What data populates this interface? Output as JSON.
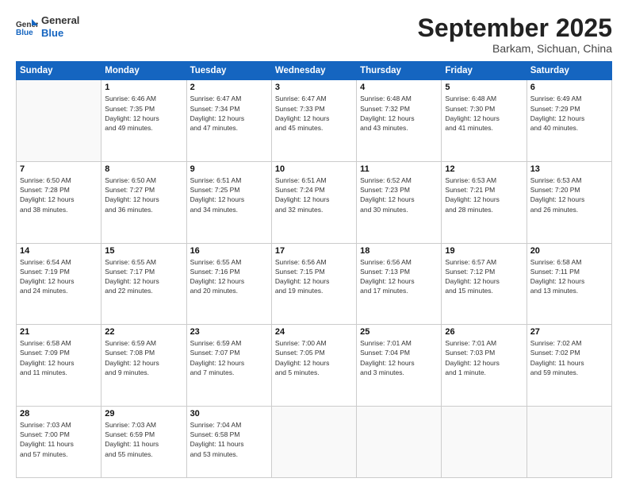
{
  "header": {
    "logo_line1": "General",
    "logo_line2": "Blue",
    "month_title": "September 2025",
    "subtitle": "Barkam, Sichuan, China"
  },
  "weekdays": [
    "Sunday",
    "Monday",
    "Tuesday",
    "Wednesday",
    "Thursday",
    "Friday",
    "Saturday"
  ],
  "weeks": [
    [
      {
        "day": "",
        "info": ""
      },
      {
        "day": "1",
        "info": "Sunrise: 6:46 AM\nSunset: 7:35 PM\nDaylight: 12 hours\nand 49 minutes."
      },
      {
        "day": "2",
        "info": "Sunrise: 6:47 AM\nSunset: 7:34 PM\nDaylight: 12 hours\nand 47 minutes."
      },
      {
        "day": "3",
        "info": "Sunrise: 6:47 AM\nSunset: 7:33 PM\nDaylight: 12 hours\nand 45 minutes."
      },
      {
        "day": "4",
        "info": "Sunrise: 6:48 AM\nSunset: 7:32 PM\nDaylight: 12 hours\nand 43 minutes."
      },
      {
        "day": "5",
        "info": "Sunrise: 6:48 AM\nSunset: 7:30 PM\nDaylight: 12 hours\nand 41 minutes."
      },
      {
        "day": "6",
        "info": "Sunrise: 6:49 AM\nSunset: 7:29 PM\nDaylight: 12 hours\nand 40 minutes."
      }
    ],
    [
      {
        "day": "7",
        "info": "Sunrise: 6:50 AM\nSunset: 7:28 PM\nDaylight: 12 hours\nand 38 minutes."
      },
      {
        "day": "8",
        "info": "Sunrise: 6:50 AM\nSunset: 7:27 PM\nDaylight: 12 hours\nand 36 minutes."
      },
      {
        "day": "9",
        "info": "Sunrise: 6:51 AM\nSunset: 7:25 PM\nDaylight: 12 hours\nand 34 minutes."
      },
      {
        "day": "10",
        "info": "Sunrise: 6:51 AM\nSunset: 7:24 PM\nDaylight: 12 hours\nand 32 minutes."
      },
      {
        "day": "11",
        "info": "Sunrise: 6:52 AM\nSunset: 7:23 PM\nDaylight: 12 hours\nand 30 minutes."
      },
      {
        "day": "12",
        "info": "Sunrise: 6:53 AM\nSunset: 7:21 PM\nDaylight: 12 hours\nand 28 minutes."
      },
      {
        "day": "13",
        "info": "Sunrise: 6:53 AM\nSunset: 7:20 PM\nDaylight: 12 hours\nand 26 minutes."
      }
    ],
    [
      {
        "day": "14",
        "info": "Sunrise: 6:54 AM\nSunset: 7:19 PM\nDaylight: 12 hours\nand 24 minutes."
      },
      {
        "day": "15",
        "info": "Sunrise: 6:55 AM\nSunset: 7:17 PM\nDaylight: 12 hours\nand 22 minutes."
      },
      {
        "day": "16",
        "info": "Sunrise: 6:55 AM\nSunset: 7:16 PM\nDaylight: 12 hours\nand 20 minutes."
      },
      {
        "day": "17",
        "info": "Sunrise: 6:56 AM\nSunset: 7:15 PM\nDaylight: 12 hours\nand 19 minutes."
      },
      {
        "day": "18",
        "info": "Sunrise: 6:56 AM\nSunset: 7:13 PM\nDaylight: 12 hours\nand 17 minutes."
      },
      {
        "day": "19",
        "info": "Sunrise: 6:57 AM\nSunset: 7:12 PM\nDaylight: 12 hours\nand 15 minutes."
      },
      {
        "day": "20",
        "info": "Sunrise: 6:58 AM\nSunset: 7:11 PM\nDaylight: 12 hours\nand 13 minutes."
      }
    ],
    [
      {
        "day": "21",
        "info": "Sunrise: 6:58 AM\nSunset: 7:09 PM\nDaylight: 12 hours\nand 11 minutes."
      },
      {
        "day": "22",
        "info": "Sunrise: 6:59 AM\nSunset: 7:08 PM\nDaylight: 12 hours\nand 9 minutes."
      },
      {
        "day": "23",
        "info": "Sunrise: 6:59 AM\nSunset: 7:07 PM\nDaylight: 12 hours\nand 7 minutes."
      },
      {
        "day": "24",
        "info": "Sunrise: 7:00 AM\nSunset: 7:05 PM\nDaylight: 12 hours\nand 5 minutes."
      },
      {
        "day": "25",
        "info": "Sunrise: 7:01 AM\nSunset: 7:04 PM\nDaylight: 12 hours\nand 3 minutes."
      },
      {
        "day": "26",
        "info": "Sunrise: 7:01 AM\nSunset: 7:03 PM\nDaylight: 12 hours\nand 1 minute."
      },
      {
        "day": "27",
        "info": "Sunrise: 7:02 AM\nSunset: 7:02 PM\nDaylight: 11 hours\nand 59 minutes."
      }
    ],
    [
      {
        "day": "28",
        "info": "Sunrise: 7:03 AM\nSunset: 7:00 PM\nDaylight: 11 hours\nand 57 minutes."
      },
      {
        "day": "29",
        "info": "Sunrise: 7:03 AM\nSunset: 6:59 PM\nDaylight: 11 hours\nand 55 minutes."
      },
      {
        "day": "30",
        "info": "Sunrise: 7:04 AM\nSunset: 6:58 PM\nDaylight: 11 hours\nand 53 minutes."
      },
      {
        "day": "",
        "info": ""
      },
      {
        "day": "",
        "info": ""
      },
      {
        "day": "",
        "info": ""
      },
      {
        "day": "",
        "info": ""
      }
    ]
  ]
}
